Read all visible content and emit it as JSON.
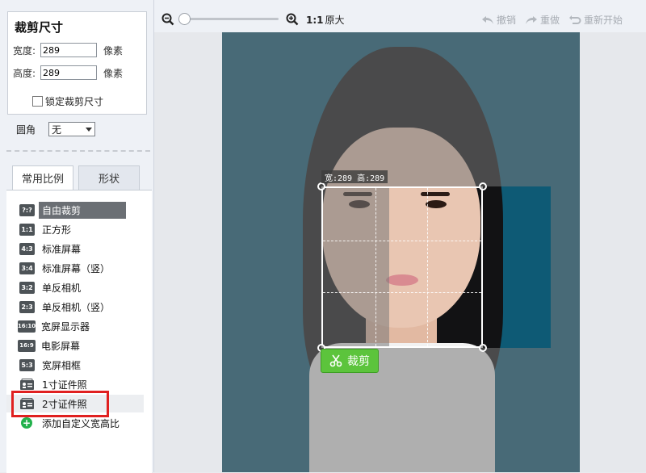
{
  "crop": {
    "title": "裁剪尺寸",
    "width_label": "宽度:",
    "width_value": "289",
    "height_label": "高度:",
    "height_value": "289",
    "unit": "像素",
    "lock_label": "锁定裁剪尺寸",
    "corner_label": "圆角",
    "corner_value": "无"
  },
  "tabs": [
    {
      "label": "常用比例",
      "active": true
    },
    {
      "label": "形状",
      "active": false
    }
  ],
  "ratios": [
    {
      "badge": "?:?",
      "label": "自由裁剪",
      "selected": true
    },
    {
      "badge": "1:1",
      "label": "正方形"
    },
    {
      "badge": "4:3",
      "label": "标准屏幕"
    },
    {
      "badge": "3:4",
      "label": "标准屏幕（竖）"
    },
    {
      "badge": "3:2",
      "label": "单反相机"
    },
    {
      "badge": "2:3",
      "label": "单反相机（竖）"
    },
    {
      "badge": "16:10",
      "label": "宽屏显示器"
    },
    {
      "badge": "16:9",
      "label": "电影屏幕"
    },
    {
      "badge": "5:3",
      "label": "宽屏相框"
    },
    {
      "badge": "id",
      "label": "1寸证件照"
    },
    {
      "badge": "id",
      "label": "2寸证件照",
      "highlighted": true
    },
    {
      "badge": "add",
      "label": "添加自定义宽高比"
    }
  ],
  "toolbar": {
    "ratio": "1:1",
    "original": "原大",
    "undo": "撤销",
    "redo": "重做",
    "restart": "重新开始",
    "zoom_fraction": 0.0
  },
  "canvas": {
    "dims_label": "宽:289 高:289",
    "crop_button": "裁剪"
  },
  "colors": {
    "photo_bg": "#0e5a75",
    "crop_button": "#5cc43c",
    "highlight_box": "#e02020"
  }
}
